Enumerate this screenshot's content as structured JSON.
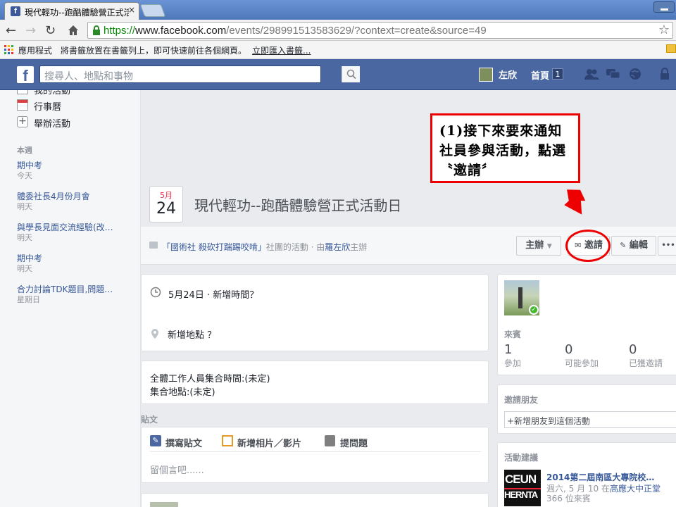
{
  "browser": {
    "tab_title": "現代輕功--跑酷體驗營正式活",
    "tab_close": "×",
    "url_scheme": "https://",
    "url_host": "www.facebook.com",
    "url_path": "/events/298991513583629/?context=create&source=49",
    "bookmarks": {
      "apps_label": "應用程式",
      "hint": "將書籤放置在書籤列上，即可快速前往各個網頁。",
      "import_link": "立即匯入書籤..."
    }
  },
  "fb_header": {
    "logo": "f",
    "search_placeholder": "搜尋人、地點和事物",
    "user_name": "左欣",
    "home_label": "首頁",
    "home_badge": "1"
  },
  "sidebar": {
    "top_items": [
      {
        "label": "我的活動"
      },
      {
        "label": "行事曆"
      },
      {
        "label": "舉辦活動"
      }
    ],
    "section_label": "本週",
    "events": [
      {
        "title": "期中考",
        "when": "今天"
      },
      {
        "title": "體委社長4月份月會",
        "when": "明天"
      },
      {
        "title": "與學長見面交流經驗(改…",
        "when": "明天"
      },
      {
        "title": "期中考",
        "when": "明天"
      },
      {
        "title": "合力討論TDK題目,問題…",
        "when": "星期日"
      }
    ]
  },
  "event": {
    "month": "5月",
    "day": "24",
    "title": "現代輕功--跑酷體驗營正式活動日",
    "host_group": "「國術社 殺砍打踹踢咬啃」",
    "host_mid": "社團的活動 · 由",
    "host_user": "羅左欣",
    "host_suffix": "主辦",
    "buttons": {
      "host": "主辦",
      "invite": "邀請",
      "edit": "編輯",
      "more": "•••"
    },
    "time": "5月24日 · 新增時間？",
    "place": "新增地點 ？",
    "description_lines": [
      "全體工作人員集合時間:(未定)",
      "集合地點:(未定)"
    ],
    "posts_label": "貼文",
    "composer": {
      "write": "撰寫貼文",
      "photo": "新增相片／影片",
      "ask": "提問題",
      "placeholder": "留個言吧......"
    }
  },
  "guests": {
    "label": "來賓",
    "stats": [
      {
        "count": "1",
        "label": "參加"
      },
      {
        "count": "0",
        "label": "可能參加"
      },
      {
        "count": "0",
        "label": "已獲邀請"
      }
    ]
  },
  "invite_friends": {
    "label": "邀請朋友",
    "input_placeholder": "+新增朋友到這個活動"
  },
  "suggestions": {
    "label": "活動建議",
    "item_title": "2014第二屆南區大專院校…",
    "item_line1_pre": "週六, 5 月 10 在",
    "item_line1_link": "高應大中正堂",
    "item_line2": "366 位來賓",
    "thumb_text_1": "CEUN",
    "thumb_text_2": "HERNTA"
  },
  "annotation": {
    "callout_text": "(1)接下來要來通知社員參與活動，點選〝邀請〞"
  },
  "colors": {
    "fb_blue": "#4b67a1",
    "link": "#365899",
    "annotation_red": "#e00000"
  }
}
